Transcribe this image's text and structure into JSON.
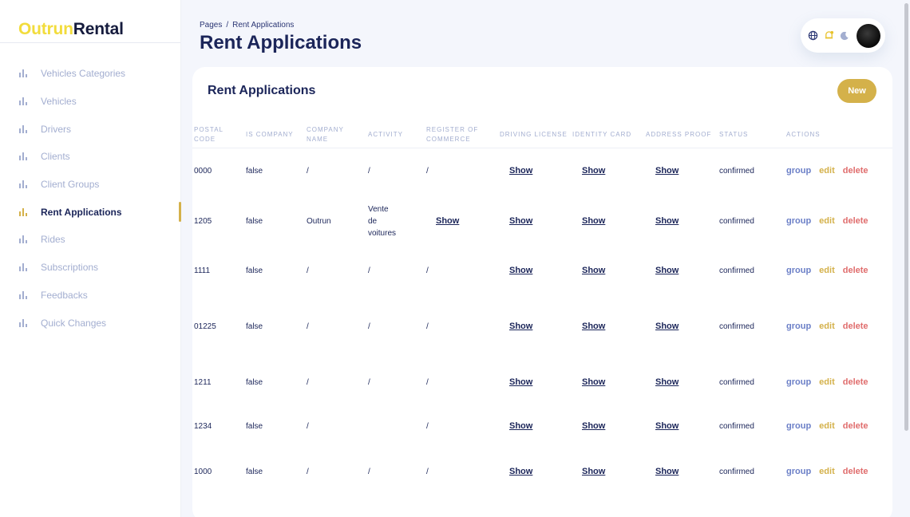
{
  "app": {
    "logo_part1": "Outrun",
    "logo_part2": "Rental"
  },
  "sidebar": {
    "items": [
      {
        "label": "Vehicles Categories",
        "icon": "bar-chart-icon",
        "active": false
      },
      {
        "label": "Vehicles",
        "icon": "bar-chart-icon",
        "active": false
      },
      {
        "label": "Drivers",
        "icon": "bar-chart-icon",
        "active": false
      },
      {
        "label": "Clients",
        "icon": "bar-chart-icon",
        "active": false
      },
      {
        "label": "Client Groups",
        "icon": "bar-chart-icon",
        "active": false
      },
      {
        "label": "Rent Applications",
        "icon": "bar-chart-icon",
        "active": true
      },
      {
        "label": "Rides",
        "icon": "bar-chart-icon",
        "active": false
      },
      {
        "label": "Subscriptions",
        "icon": "bar-chart-icon",
        "active": false
      },
      {
        "label": "Feedbacks",
        "icon": "bar-chart-icon",
        "active": false
      },
      {
        "label": "Quick Changes",
        "icon": "bar-chart-icon",
        "active": false
      }
    ]
  },
  "header": {
    "breadcrumb_root": "Pages",
    "breadcrumb_separator": "/",
    "breadcrumb_current": "Rent Applications",
    "title": "Rent Applications",
    "icons": [
      "globe-icon",
      "notification-icon",
      "moon-icon",
      "avatar"
    ]
  },
  "card": {
    "title": "Rent Applications",
    "new_label": "New",
    "columns": [
      {
        "key": "postal_code",
        "label": "POSTAL CODE"
      },
      {
        "key": "is_company",
        "label": "IS COMPANY"
      },
      {
        "key": "company_name",
        "label": "COMPANY NAME"
      },
      {
        "key": "activity",
        "label": "ACTIVITY"
      },
      {
        "key": "register_of_commerce",
        "label": "REGISTER OF COMMERCE"
      },
      {
        "key": "driving_license",
        "label": "DRIVING LICENSE"
      },
      {
        "key": "identity_card",
        "label": "IDENTITY CARD"
      },
      {
        "key": "address_proof",
        "label": "ADDRESS PROOF"
      },
      {
        "key": "status",
        "label": "STATUS"
      },
      {
        "key": "actions",
        "label": "ACTIONS"
      }
    ],
    "action_labels": {
      "group": "group",
      "edit": "edit",
      "delete": "delete"
    },
    "rows": [
      {
        "postal_code": "0000",
        "is_company": "false",
        "company_name": "/",
        "activity": "/",
        "register_of_commerce": "/",
        "driving_license": "Show",
        "identity_card": "Show",
        "address_proof": "Show",
        "status": "confirmed"
      },
      {
        "postal_code": "1205",
        "is_company": "false",
        "company_name": "Outrun",
        "activity": "Vente\nde\nvoitures",
        "register_of_commerce": "Show",
        "driving_license": "Show",
        "identity_card": "Show",
        "address_proof": "Show",
        "status": "confirmed"
      },
      {
        "postal_code": "1111",
        "is_company": "false",
        "company_name": "/",
        "activity": "/",
        "register_of_commerce": "/",
        "driving_license": "Show",
        "identity_card": "Show",
        "address_proof": "Show",
        "status": "confirmed"
      },
      {
        "postal_code": "01225",
        "is_company": "false",
        "company_name": "/",
        "activity": "/",
        "register_of_commerce": "/",
        "driving_license": "Show",
        "identity_card": "Show",
        "address_proof": "Show",
        "status": "confirmed"
      },
      {
        "postal_code": "1211",
        "is_company": "false",
        "company_name": "/",
        "activity": "/",
        "register_of_commerce": "/",
        "driving_license": "Show",
        "identity_card": "Show",
        "address_proof": "Show",
        "status": "confirmed"
      },
      {
        "postal_code": "1234",
        "is_company": "false",
        "company_name": "/",
        "activity": "",
        "register_of_commerce": "/",
        "driving_license": "Show",
        "identity_card": "Show",
        "address_proof": "Show",
        "status": "confirmed"
      },
      {
        "postal_code": "1000",
        "is_company": "false",
        "company_name": "/",
        "activity": "/",
        "register_of_commerce": "/",
        "driving_license": "Show",
        "identity_card": "Show",
        "address_proof": "Show",
        "status": "confirmed"
      }
    ]
  }
}
